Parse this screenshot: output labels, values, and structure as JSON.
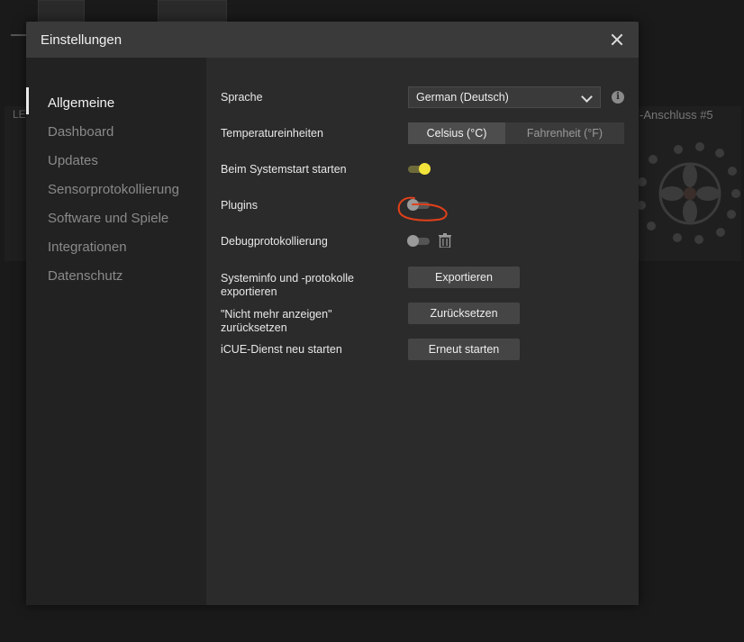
{
  "background": {
    "left_label": "LE",
    "right_label": "-Anschluss #5"
  },
  "dialog": {
    "title": "Einstellungen"
  },
  "sidebar": {
    "items": [
      {
        "label": "Allgemeine",
        "active": true
      },
      {
        "label": "Dashboard",
        "active": false
      },
      {
        "label": "Updates",
        "active": false
      },
      {
        "label": "Sensorprotokollierung",
        "active": false
      },
      {
        "label": "Software und Spiele",
        "active": false
      },
      {
        "label": "Integrationen",
        "active": false
      },
      {
        "label": "Datenschutz",
        "active": false
      }
    ]
  },
  "settings": {
    "language_label": "Sprache",
    "language_value": "German (Deutsch)",
    "temperature_label": "Temperatureinheiten",
    "celsius": "Celsius (°C)",
    "fahrenheit": "Fahrenheit (°F)",
    "startup_label": "Beim Systemstart starten",
    "startup_on": true,
    "plugins_label": "Plugins",
    "plugins_on": false,
    "debug_label": "Debugprotokollierung",
    "debug_on": false,
    "sysinfo_label_1": "Systeminfo und -protokolle",
    "sysinfo_label_2": "exportieren",
    "export_button": "Exportieren",
    "dontshow_label_1": "\"Nicht mehr anzeigen\"",
    "dontshow_label_2": "zurücksetzen",
    "reset_button": "Zurücksetzen",
    "service_label": "iCUE-Dienst neu starten",
    "restart_button": "Erneut starten"
  },
  "colors": {
    "toggle_on": "#f2e43a",
    "annotation": "#e0401a"
  }
}
